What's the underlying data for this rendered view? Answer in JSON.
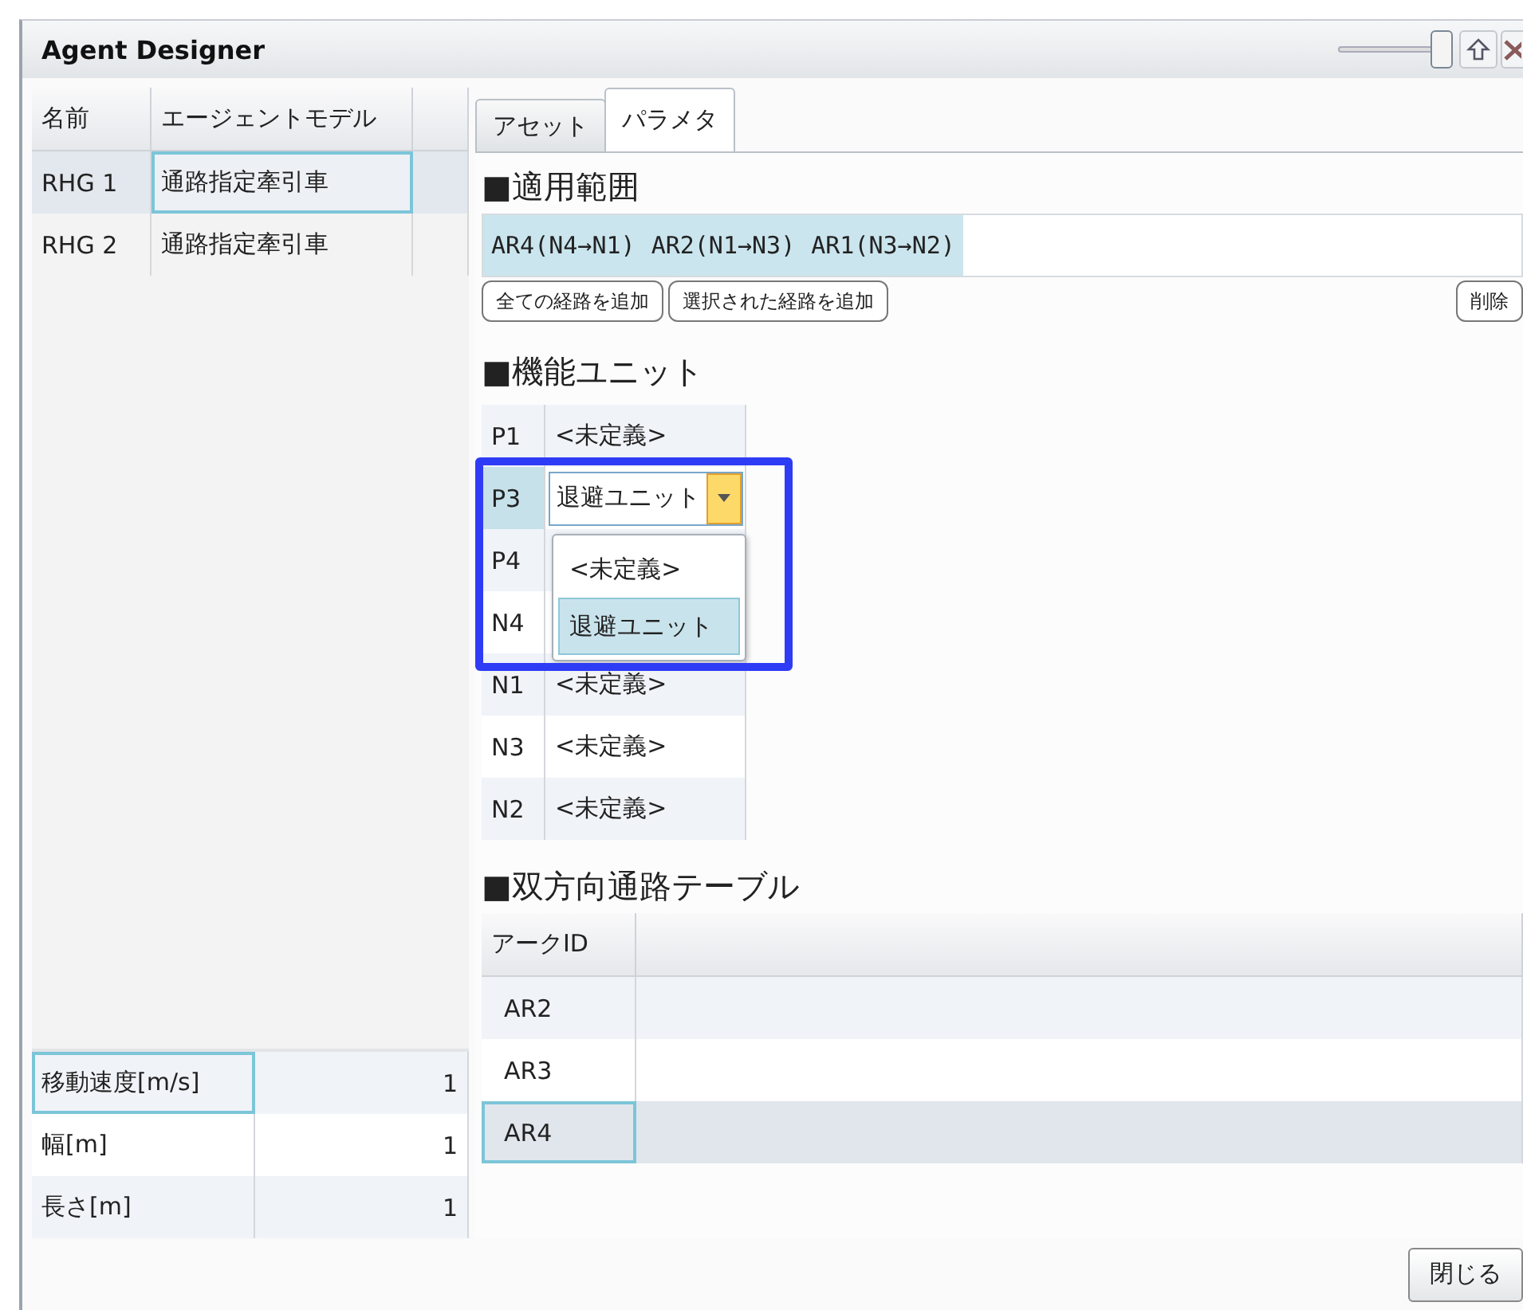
{
  "window": {
    "title": "Agent Designer",
    "zoom_slider": {
      "level": 1
    }
  },
  "agents": {
    "columns": [
      "名前",
      "エージェントモデル"
    ],
    "rows": [
      {
        "name": "RHG 1",
        "model": "通路指定牽引車",
        "selected": true
      },
      {
        "name": "RHG 2",
        "model": "通路指定牽引車",
        "selected": false
      }
    ]
  },
  "properties": [
    {
      "label": "移動速度[m/s]",
      "value": "1",
      "selected": true
    },
    {
      "label": "幅[m]",
      "value": "1",
      "selected": false
    },
    {
      "label": "長さ[m]",
      "value": "1",
      "selected": false
    }
  ],
  "tabs": [
    {
      "label": "アセット",
      "selected": false
    },
    {
      "label": "パラメタ",
      "selected": true
    }
  ],
  "scope": {
    "heading": "■適用範囲",
    "routes": [
      {
        "label": "AR4(N4→N1)",
        "selected": true
      },
      {
        "label": "AR2(N1→N3)",
        "selected": true
      },
      {
        "label": "AR1(N3→N2)",
        "selected": true
      }
    ],
    "buttons": [
      "全ての経路を追加",
      "選択された経路を追加"
    ],
    "delete_button": "削除"
  },
  "units": {
    "heading": "■機能ユニット",
    "rows": [
      {
        "port": "P1",
        "value": "<未定義>",
        "kind": "text"
      },
      {
        "port": "P3",
        "value": "退避ユニット",
        "kind": "combo"
      },
      {
        "port": "P4",
        "kind": "hidden"
      },
      {
        "port": "N4",
        "kind": "hidden"
      },
      {
        "port": "N1",
        "value": "<未定義>",
        "kind": "text"
      },
      {
        "port": "N3",
        "value": "<未定義>",
        "kind": "text"
      },
      {
        "port": "N2",
        "value": "<未定義>",
        "kind": "text"
      }
    ],
    "dropdown": [
      {
        "label": "<未定義>",
        "selected": false
      },
      {
        "label": "退避ユニット",
        "selected": true
      }
    ]
  },
  "arcs": {
    "heading": "■双方向通路テーブル",
    "columns": [
      "アークID"
    ],
    "rows": [
      {
        "id": "AR2",
        "selected": false
      },
      {
        "id": "AR3",
        "selected": false
      },
      {
        "id": "AR4",
        "selected": true
      }
    ]
  },
  "close_button": "閉じる"
}
